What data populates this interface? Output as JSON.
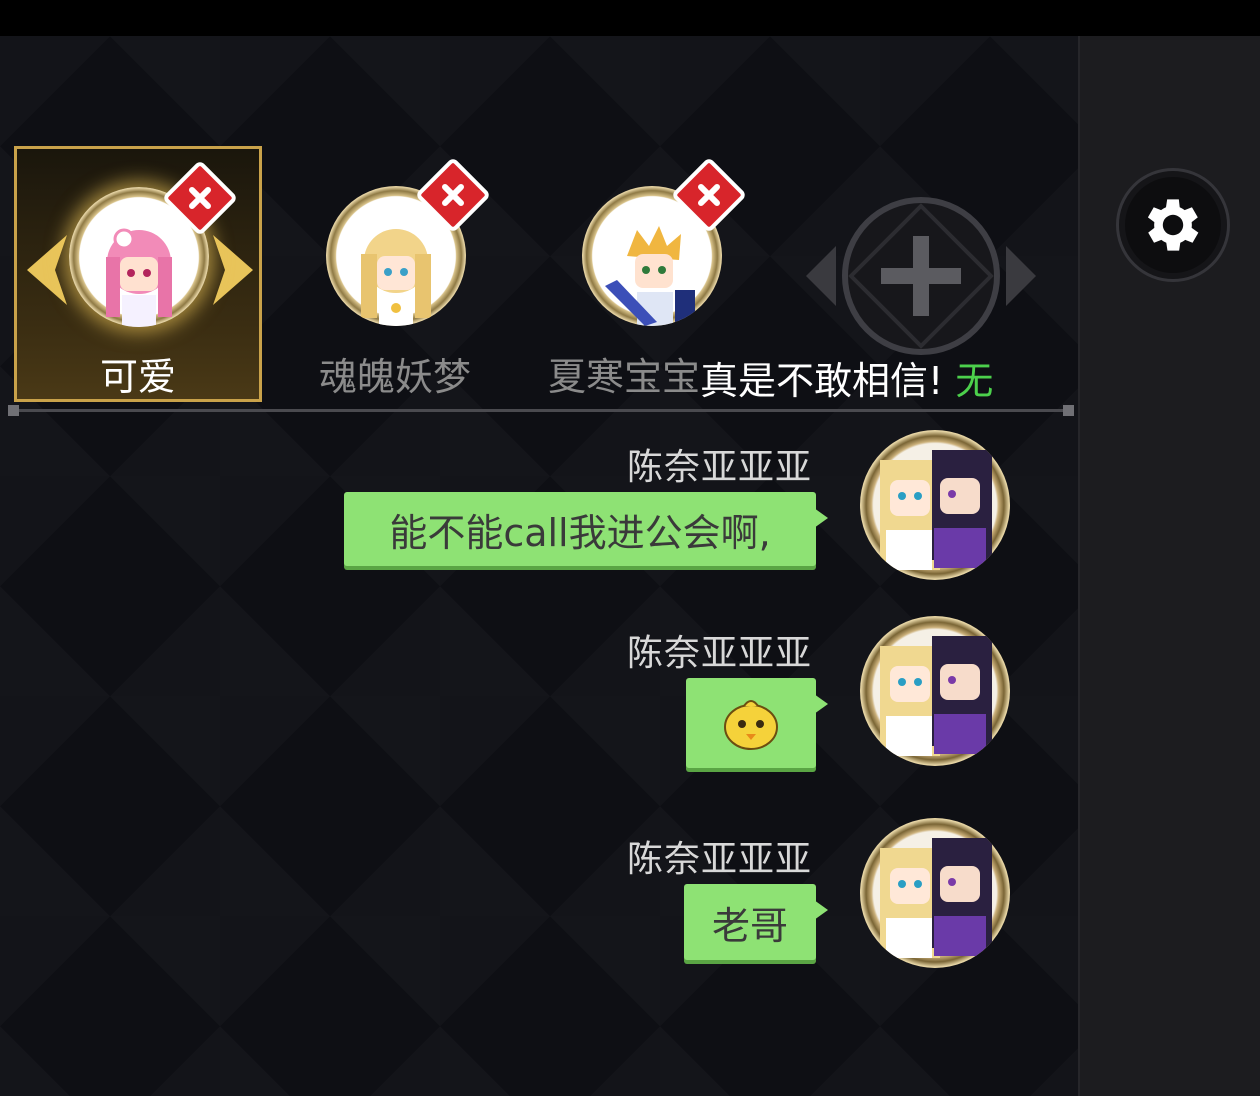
{
  "tabs": [
    {
      "label": "可爱",
      "active": true
    },
    {
      "label": "魂魄妖梦",
      "active": false
    },
    {
      "label": "夏寒宝宝",
      "active": false
    }
  ],
  "add_tab_icon": "plus-icon",
  "ticker": {
    "text": "真是不敢相信!",
    "more": "无"
  },
  "settings_icon": "gear-icon",
  "messages": [
    {
      "sender": "陈奈亚亚亚",
      "text": "能不能call我进公会啊,"
    },
    {
      "sender": "陈奈亚亚亚",
      "emoji": "chick-emoji"
    },
    {
      "sender": "陈奈亚亚亚",
      "text": "老哥"
    }
  ],
  "colors": {
    "bubble": "#8ee274",
    "active_tab_border": "#c9a24a",
    "badge": "#d8252b"
  }
}
